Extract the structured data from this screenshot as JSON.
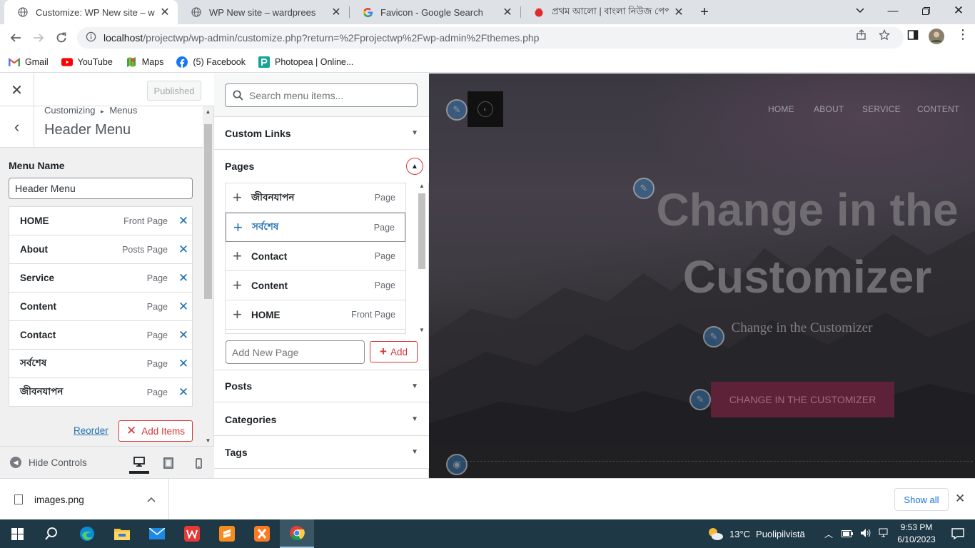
{
  "browser": {
    "tabs": [
      {
        "title": "Customize: WP New site – wardp",
        "active": true,
        "icon": "globe-icon"
      },
      {
        "title": "WP New site – wardprees",
        "active": false,
        "icon": "globe-icon"
      },
      {
        "title": "Favicon - Google Search",
        "active": false,
        "icon": "google-icon"
      },
      {
        "title": "প্রথম আলো | বাংলা নিউজ পেপার",
        "active": false,
        "icon": "prothomalo-icon"
      }
    ],
    "url_host": "localhost",
    "url_path": "/projectwp/wp-admin/customize.php?return=%2Fprojectwp%2Fwp-admin%2Fthemes.php",
    "bookmarks": [
      "Gmail",
      "YouTube",
      "Maps",
      "(5) Facebook",
      "Photopea | Online..."
    ]
  },
  "customizer": {
    "published_label": "Published",
    "breadcrumb_root": "Customizing",
    "breadcrumb_sep": "▸",
    "breadcrumb_section": "Menus",
    "panel_title": "Header Menu",
    "menu_name_label": "Menu Name",
    "menu_name_value": "Header Menu",
    "menu_items": [
      {
        "title": "HOME",
        "type": "Front Page"
      },
      {
        "title": "About",
        "type": "Posts Page"
      },
      {
        "title": "Service",
        "type": "Page"
      },
      {
        "title": "Content",
        "type": "Page"
      },
      {
        "title": "Contact",
        "type": "Page"
      },
      {
        "title": "সর্বশেষ",
        "type": "Page"
      },
      {
        "title": "জীবনযাপন",
        "type": "Page"
      }
    ],
    "reorder_label": "Reorder",
    "add_items_label": "Add Items",
    "hide_controls_label": "Hide Controls"
  },
  "available": {
    "search_placeholder": "Search menu items...",
    "sections": {
      "custom_links": "Custom Links",
      "pages": "Pages",
      "posts": "Posts",
      "categories": "Categories",
      "tags": "Tags"
    },
    "pages": [
      {
        "title": "জীবনযাপন",
        "type": "Page"
      },
      {
        "title": "সর্বশেষ",
        "type": "Page"
      },
      {
        "title": "Contact",
        "type": "Page"
      },
      {
        "title": "Content",
        "type": "Page"
      },
      {
        "title": "HOME",
        "type": "Front Page"
      }
    ],
    "add_new_page_placeholder": "Add New Page",
    "add_label": "Add"
  },
  "preview": {
    "nav": [
      "HOME",
      "ABOUT",
      "SERVICE",
      "CONTENT"
    ],
    "hero_title_line1": "Change in the",
    "hero_title_line2": "Customizer",
    "hero_subtitle": "Change in the Customizer",
    "hero_button": "CHANGE IN THE CUSTOMIZER"
  },
  "downloads": {
    "file_name": "images.png",
    "show_all_label": "Show all"
  },
  "taskbar": {
    "temperature": "13°C",
    "weather_text": "Puolipilvistä",
    "time": "9:53 PM",
    "date": "6/10/2023"
  },
  "colors": {
    "accent_blue": "#2271b1",
    "delete_red": "#d63638",
    "hero_button": "#5d2238"
  }
}
